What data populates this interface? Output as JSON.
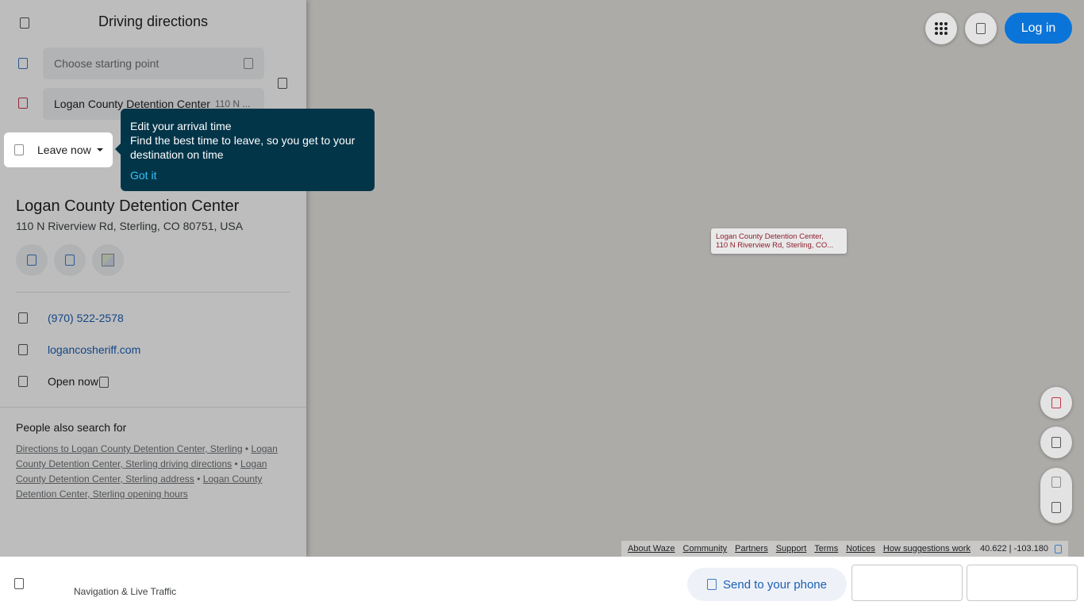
{
  "panel": {
    "title": "Driving directions",
    "start_placeholder": "Choose starting point",
    "destination_name": "Logan County Detention Center",
    "destination_sub": "110 N ...",
    "leave_label": "Leave now"
  },
  "tooltip": {
    "title": "Edit your arrival time",
    "body": "Find the best time to leave, so you get to your destination on time",
    "action": "Got it"
  },
  "place": {
    "name": "Logan County Detention Center",
    "address": "110 N Riverview Rd, Sterling, CO 80751, USA",
    "phone": "(970) 522-2578",
    "website": "logancosheriff.com",
    "hours_status": "Open now"
  },
  "also_search": {
    "title": "People also search for",
    "links": [
      "Directions to Logan County Detention Center, Sterling",
      "Logan County Detention Center, Sterling driving directions",
      "Logan County Detention Center, Sterling address",
      "Logan County Detention Center, Sterling opening hours"
    ],
    "separator": "•"
  },
  "header": {
    "login_label": "Log in"
  },
  "map": {
    "marker_line1": "Logan County Detention Center,",
    "marker_line2": "110 N Riverview Rd, Sterling, CO..."
  },
  "attribution": {
    "links": [
      "About Waze",
      "Community",
      "Partners",
      "Support",
      "Terms",
      "Notices",
      "How suggestions work"
    ],
    "coordinates": "40.622 | -103.180"
  },
  "bottom_bar": {
    "tagline": "Navigation & Live Traffic",
    "send_label": "Send to your phone"
  },
  "colors": {
    "accent_blue": "#0a74d9",
    "tooltip_bg": "#033549",
    "tooltip_link": "#39c2f2",
    "link_blue": "#1a5fb4",
    "marker_text": "#8e1d2b"
  }
}
